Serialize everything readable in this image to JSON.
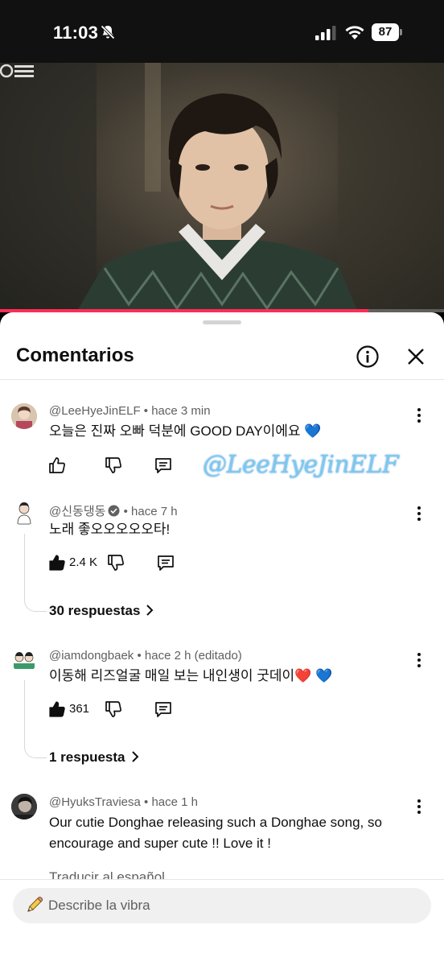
{
  "status_bar": {
    "time": "11:03",
    "battery": "87"
  },
  "video": {
    "progress_fraction": 0.83
  },
  "sheet": {
    "title": "Comentarios"
  },
  "comments": [
    {
      "author": "@LeeHyeJinELF",
      "time": "hace 3 min",
      "text": "오늘은 진짜 오빠 덕분에 GOOD DAY이에요 💙",
      "likes": ""
    },
    {
      "author": "@신동댕동",
      "time": "hace 7 h",
      "text": "노래 좋오오오오오타!",
      "likes": "2.4 K",
      "replies": "30 respuestas"
    },
    {
      "author": "@iamdongbaek",
      "time": "hace 2 h (editado)",
      "text": "이동해 리즈얼굴 매일 보는 내인생이 굿데이❤️ 💙",
      "likes": "361",
      "replies": "1 respuesta"
    },
    {
      "author": "@HyuksTraviesa",
      "time": "hace 1 h",
      "text": "Our cutie Donghae releasing such a Donghae song, so encourage and super cute !! Love it !",
      "translate": "Traducir al español"
    }
  ],
  "overlay_watermark": "@LeeHyeJinELF",
  "input": {
    "placeholder": "Describe la vibra"
  },
  "icons": {
    "mute": "bell-slash-icon",
    "info": "info-circle-icon",
    "close": "close-icon",
    "like": "thumb-up-icon",
    "dislike": "thumb-down-icon",
    "reply": "comment-icon",
    "more": "kebab-icon",
    "pencil": "pencil-icon"
  },
  "colors": {
    "progress": "#ff2d55",
    "text": "#0f0f0f",
    "secondary": "#606060",
    "watermark": "#7ec8f0"
  }
}
